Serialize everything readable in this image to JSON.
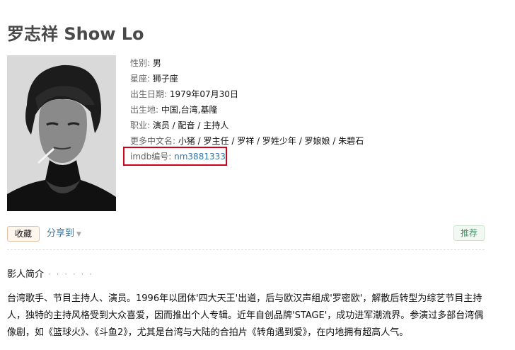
{
  "header": {
    "title": "罗志祥 Show Lo"
  },
  "photo": {
    "alt_icon": "portrait-photo"
  },
  "info": {
    "gender_label": "性别:",
    "gender_value": " 男",
    "constellation_label": "星座:",
    "constellation_value": " 狮子座",
    "birthdate_label": "出生日期:",
    "birthdate_value": " 1979年07月30日",
    "birthplace_label": "出生地:",
    "birthplace_value": " 中国,台湾,基隆",
    "profession_label": "职业:",
    "profession_value": " 演员 / 配音 / 主持人",
    "more_names_label": "更多中文名:",
    "more_names_value": " 小猪 / 罗主任 / 罗祥 / 罗姓少年 / 罗娘娘 / 朱碧石",
    "imdb_label": "imdb编号:",
    "imdb_value": " nm3881333"
  },
  "actions": {
    "collect_label": "收藏",
    "share_label": "分享到",
    "share_caret": "▼",
    "recommend_label": "推荐"
  },
  "intro": {
    "section_title": "影人简介",
    "dots": "· · · · · ·",
    "bio": "台湾歌手、节目主持人、演员。1996年以团体'四大天王'出道，后与欧汉声组成'罗密欧'，解散后转型为综艺节目主持人，独特的主持风格受到大众喜爱，因而推出个人专辑。近年自创品牌'STAGE'，成功进军潮流界。参演过多部台湾偶像剧，如《篮球火》、《斗鱼2》，尤其是台湾与大陆的合拍片《转角遇到爱》，在内地拥有超高人气。"
  },
  "colors": {
    "highlight_border": "#d0021b",
    "link": "#3377aa",
    "recommend_text": "#4f946e"
  }
}
